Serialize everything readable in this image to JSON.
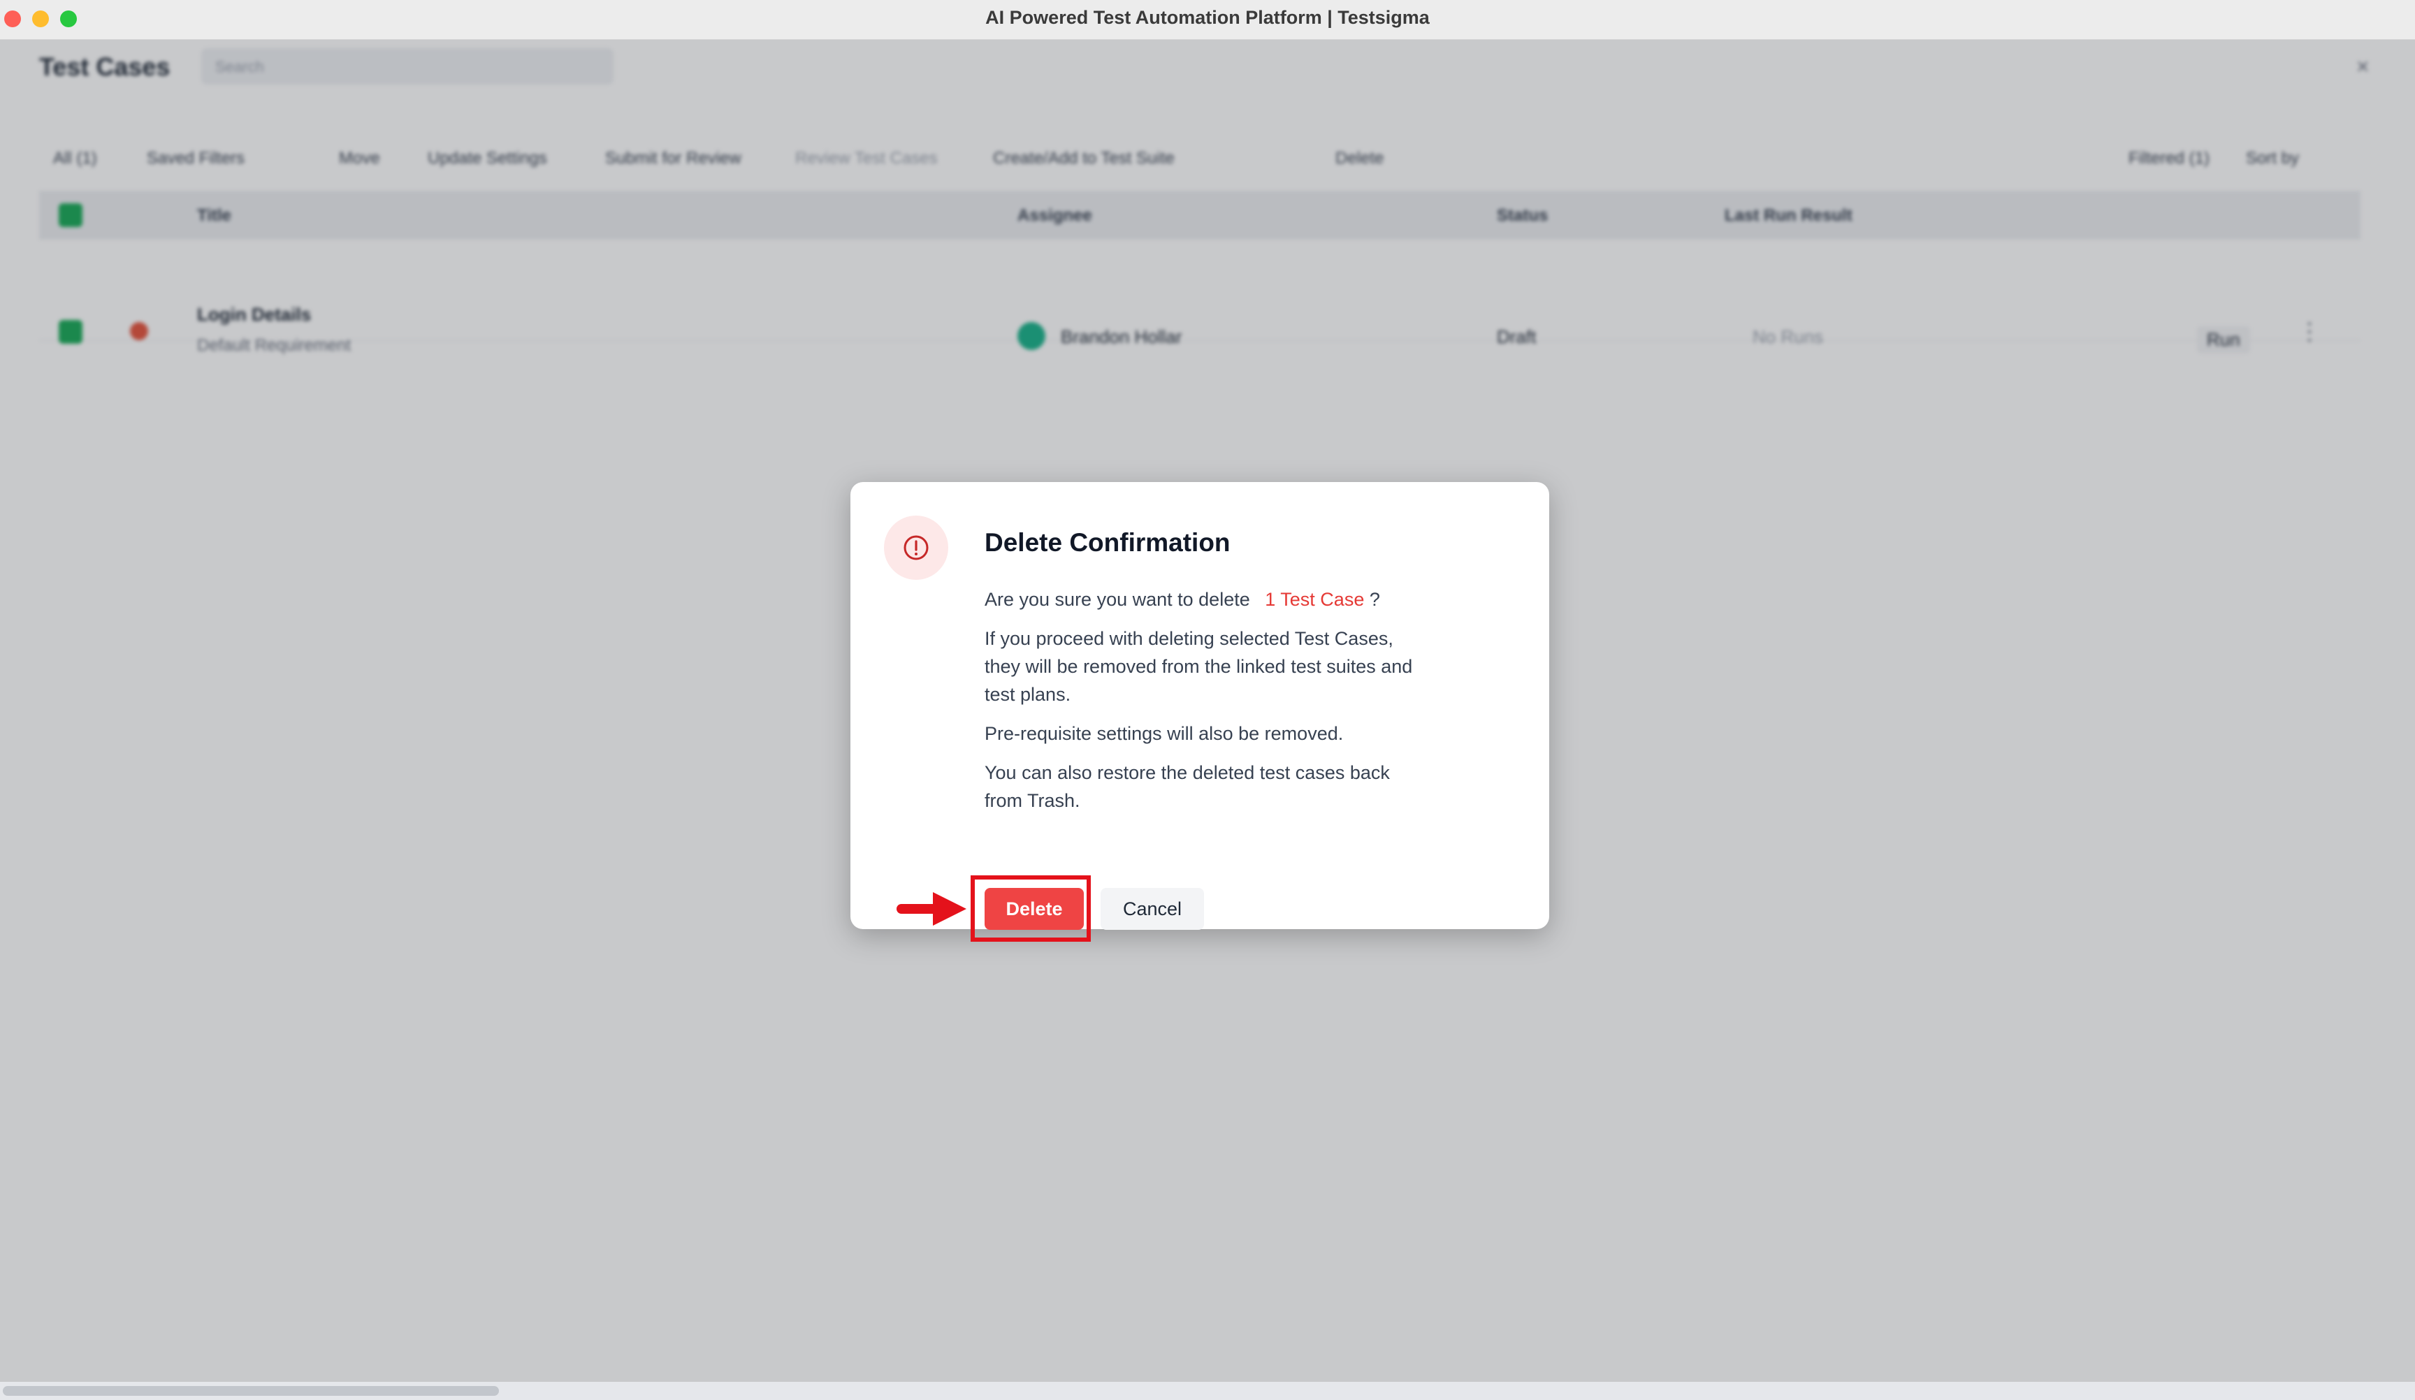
{
  "window": {
    "title": "AI Powered Test Automation Platform | Testsigma"
  },
  "background": {
    "page_title": "Test Cases",
    "search_placeholder": "Search",
    "close_symbol": "×",
    "toolbar": {
      "all": "All (1)",
      "saved_filters": "Saved Filters",
      "move": "Move",
      "update_settings": "Update Settings",
      "submit_for_review": "Submit for Review",
      "review_test_cases": "Review Test Cases",
      "create_add": "Create/Add to Test Suite",
      "delete": "Delete",
      "filtered": "Filtered (1)",
      "sort_by": "Sort by"
    },
    "table": {
      "headers": {
        "title": "Title",
        "assignee": "Assignee",
        "status": "Status",
        "last_run": "Last Run Result"
      },
      "row": {
        "title": "Login Details",
        "requirement": "Default Requirement",
        "assignee": "Brandon Hollar",
        "status": "Draft",
        "last_run": "No Runs",
        "run": "Run"
      }
    }
  },
  "modal": {
    "title": "Delete Confirmation",
    "question_prefix": "Are you sure you want to delete",
    "question_highlight": "1 Test Case",
    "question_suffix": "?",
    "para1_line1": "If you proceed with deleting selected Test Cases,",
    "para1_line2": "they will be removed from the linked test suites and",
    "para1_line3": "test plans.",
    "para2": "Pre-requisite settings will also be removed.",
    "para3_line1": "You can also restore the deleted test cases back",
    "para3_line2": "from Trash.",
    "delete_label": "Delete",
    "cancel_label": "Cancel"
  },
  "colors": {
    "danger": "#ef4444",
    "highlight": "#e4121b",
    "success": "#18a957"
  },
  "icons": {
    "alert": "alert-circle-icon",
    "arrow": "red-arrow-annotation"
  }
}
